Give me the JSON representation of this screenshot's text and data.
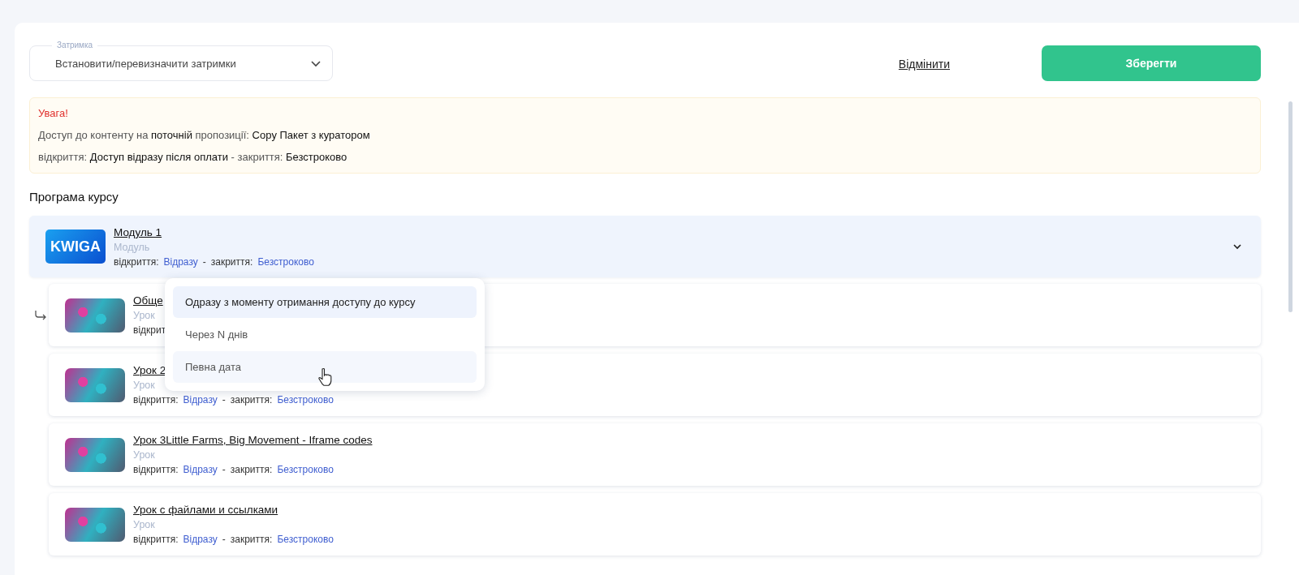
{
  "delay_field": {
    "label": "Затримка",
    "value": "Встановити/перевизначити затримки"
  },
  "actions": {
    "cancel": "Відмінити",
    "save": "Зберегти"
  },
  "notice": {
    "title": "Увага!",
    "line1": [
      {
        "text": "Доступ до контенту на ",
        "strong": false
      },
      {
        "text": "поточній",
        "strong": true
      },
      {
        "text": " пропозиції: ",
        "strong": false
      },
      {
        "text": " Copy Пакет з куратором",
        "strong": true
      }
    ],
    "line2": [
      {
        "text": "відкриття: ",
        "strong": false
      },
      {
        "text": "Доступ відразу після оплати",
        "strong": true
      },
      {
        "text": " - закриття: ",
        "strong": false
      },
      {
        "text": "Безстроково",
        "strong": true
      }
    ]
  },
  "section_title": "Програма курсу",
  "module": {
    "logo_text": "KWIGA",
    "title": "Модуль 1",
    "type": "Модуль",
    "open_label": "відкриття:",
    "open_value": "Відразу",
    "separator": "-",
    "close_label": "закриття:",
    "close_value": "Безстроково",
    "expanded": true
  },
  "lessons": [
    {
      "title": "Обще",
      "type": "Урок",
      "open_label": "відкрит",
      "nested": true
    },
    {
      "title": "Урок 2",
      "type": "Урок",
      "open_label": "відкриття:",
      "open_value": "Відразу",
      "separator": "-",
      "close_label": "закриття:",
      "close_value": "Безстроково",
      "nested": false
    },
    {
      "title": "Урок 3Little Farms, Big Movement  - Iframe codes",
      "type": "Урок",
      "open_label": "відкриття:",
      "open_value": "Відразу",
      "separator": "-",
      "close_label": "закриття:",
      "close_value": "Безстроково",
      "nested": false
    },
    {
      "title": "Урок с файлами и ссылками",
      "type": "Урок",
      "open_label": "відкриття:",
      "open_value": "Відразу",
      "separator": "-",
      "close_label": "закриття:",
      "close_value": "Безстроково",
      "nested": false
    }
  ],
  "open_menu": {
    "options": [
      {
        "label": "Одразу з моменту отримання доступу до курсу",
        "selected": true,
        "hovered": false
      },
      {
        "label": "Через N днів",
        "selected": false,
        "hovered": false
      },
      {
        "label": "Певна дата",
        "selected": false,
        "hovered": true
      }
    ]
  }
}
